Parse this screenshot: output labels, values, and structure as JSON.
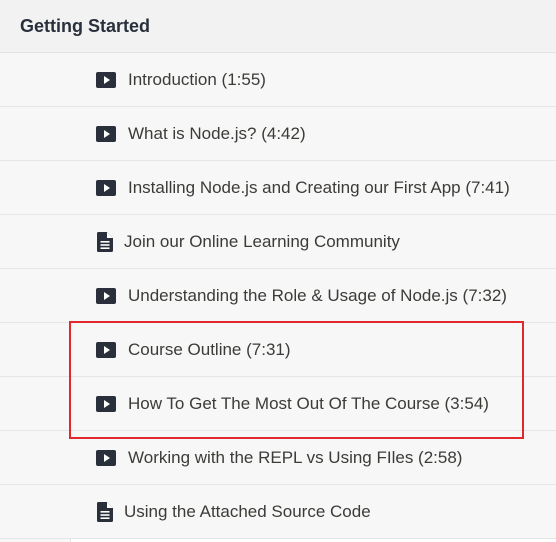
{
  "section": {
    "title": "Getting Started"
  },
  "lectures": [
    {
      "icon": "play-video-icon",
      "label": "Introduction (1:55)"
    },
    {
      "icon": "play-video-icon",
      "label": "What is Node.js? (4:42)"
    },
    {
      "icon": "play-video-icon",
      "label": "Installing Node.js and Creating our First App (7:41)"
    },
    {
      "icon": "document-icon",
      "label": "Join our Online Learning Community"
    },
    {
      "icon": "play-video-icon",
      "label": "Understanding the Role & Usage of Node.js (7:32)"
    },
    {
      "icon": "play-video-icon",
      "label": "Course Outline (7:31)"
    },
    {
      "icon": "play-video-icon",
      "label": "How To Get The Most Out Of The Course (3:54)"
    },
    {
      "icon": "play-video-icon",
      "label": "Working with the REPL vs Using FIles (2:58)"
    },
    {
      "icon": "document-icon",
      "label": "Using the Attached Source Code"
    }
  ],
  "colors": {
    "highlight_border": "#e0282d",
    "text": "#3c3b37",
    "header_bg": "#f2f2f2"
  }
}
